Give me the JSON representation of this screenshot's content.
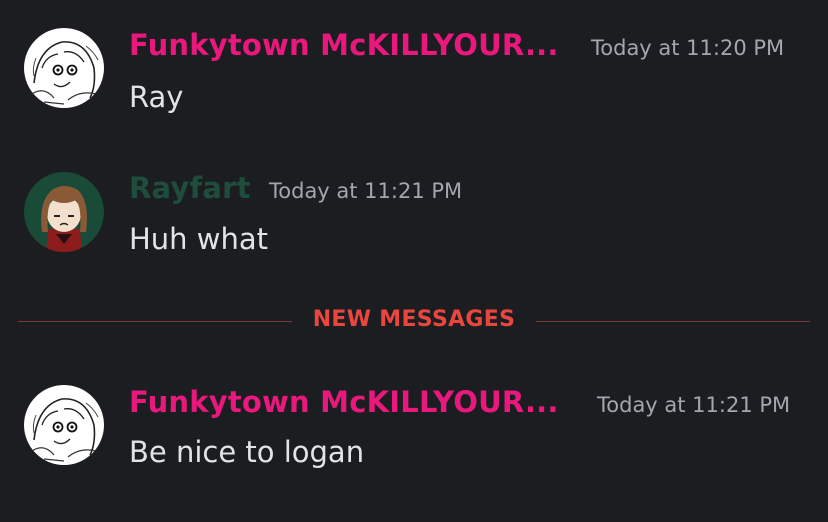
{
  "colors": {
    "background": "#1c1d21",
    "funkytown_name": "#e8187c",
    "rayfart_name": "#1f4d3b",
    "new_messages": "#e9463f",
    "timestamp": "#a4a6ad",
    "message_text": "#e2e3e7"
  },
  "messages": [
    {
      "username": "Funkytown McKILLYOUR...",
      "timestamp": "Today at 11:20 PM",
      "content": "Ray",
      "avatar": "sketch-girl-avatar"
    },
    {
      "username": "Rayfart",
      "timestamp": "Today at 11:21 PM",
      "content": "Huh what",
      "avatar": "brown-hair-character-avatar"
    },
    {
      "username": "Funkytown McKILLYOUR...",
      "timestamp": "Today at 11:21 PM",
      "content": "Be nice to logan",
      "avatar": "sketch-girl-avatar"
    }
  ],
  "divider": {
    "label": "NEW MESSAGES"
  }
}
